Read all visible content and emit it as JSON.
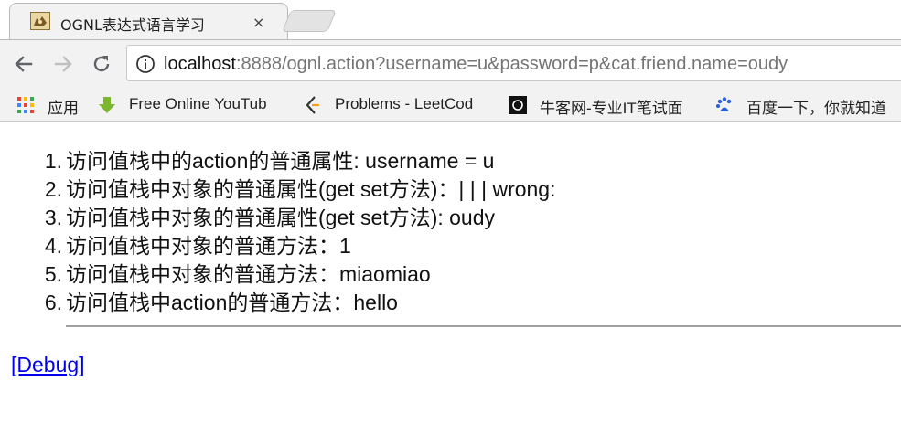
{
  "tab": {
    "title": "OGNL表达式语言学习",
    "close_symbol": "×"
  },
  "toolbar": {
    "url_host": "localhost",
    "url_rest": ":8888/ognl.action?username=u&password=p&cat.friend.name=oudy"
  },
  "bookmarks": [
    {
      "label": "应用",
      "icon": "apps-grid-icon"
    },
    {
      "label": "Free Online YouTub",
      "icon": "download-arrow-icon"
    },
    {
      "label": "Problems - LeetCod",
      "icon": "leetcode-icon"
    },
    {
      "label": "牛客网-专业IT笔试面",
      "icon": "nowcoder-icon"
    },
    {
      "label": "百度一下，你就知道",
      "icon": "baidu-paw-icon"
    }
  ],
  "content": {
    "items": [
      {
        "num": "1.",
        "text": "访问值栈中的action的普通属性: username = u"
      },
      {
        "num": "2.",
        "text": "访问值栈中对象的普通属性(get set方法)：| | | wrong:"
      },
      {
        "num": "3.",
        "text": "访问值栈中对象的普通属性(get set方法): oudy"
      },
      {
        "num": "4.",
        "text": "访问值栈中对象的普通方法：1"
      },
      {
        "num": "5.",
        "text": "访问值栈中对象的普通方法：miaomiao"
      },
      {
        "num": "6.",
        "text": "访问值栈中action的普通方法：hello"
      }
    ],
    "debug_link": "[Debug]"
  },
  "colors": {
    "link": "#0000ee",
    "chrome_bg": "#f2f2f2"
  }
}
